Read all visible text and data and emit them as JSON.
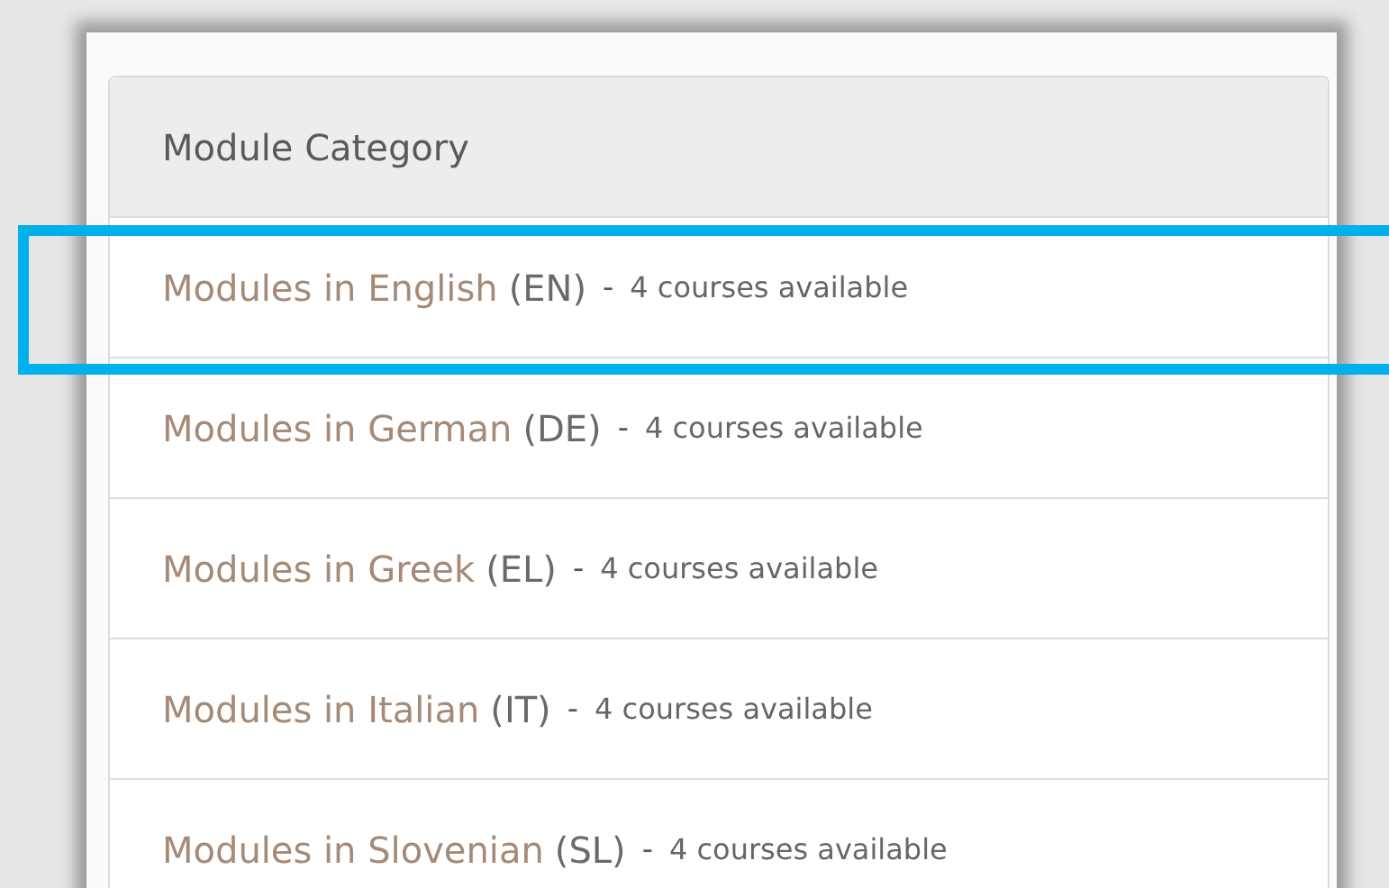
{
  "panel": {
    "heading": "Module Category"
  },
  "categories": [
    {
      "name": "Modules in English",
      "code": "(EN)",
      "separator": "-",
      "count": "4 courses available",
      "highlighted": true
    },
    {
      "name": "Modules in German",
      "code": "(DE)",
      "separator": "-",
      "count": "4 courses available",
      "highlighted": false
    },
    {
      "name": "Modules in Greek",
      "code": "(EL)",
      "separator": "-",
      "count": "4 courses available",
      "highlighted": false
    },
    {
      "name": "Modules in Italian",
      "code": "(IT)",
      "separator": "-",
      "count": "4 courses available",
      "highlighted": false
    },
    {
      "name": "Modules in Slovenian",
      "code": "(SL)",
      "separator": "-",
      "count": "4 courses available",
      "highlighted": false
    }
  ]
}
